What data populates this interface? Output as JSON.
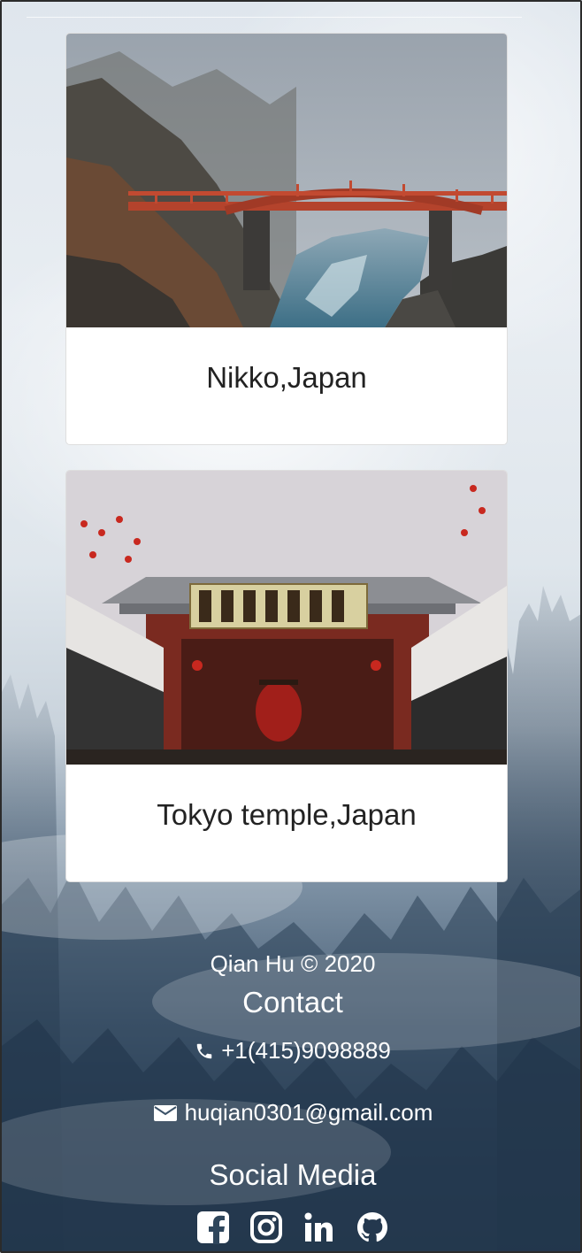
{
  "cards": [
    {
      "caption": "Nikko,Japan",
      "image": "red-bridge-over-misty-river-photo"
    },
    {
      "caption": "Tokyo temple,Japan",
      "image": "senso-ji-temple-gate-photo"
    }
  ],
  "footer": {
    "copyright": "Qian Hu © 2020",
    "contact_title": "Contact",
    "phone": "+1(415)9098889",
    "email": "huqian0301@gmail.com",
    "social_title": "Social Media",
    "social_icons": [
      "facebook-icon",
      "instagram-icon",
      "linkedin-icon",
      "github-icon"
    ]
  },
  "colors": {
    "caption_text": "#222222",
    "footer_text": "#ffffff",
    "card_bg": "#ffffff"
  }
}
